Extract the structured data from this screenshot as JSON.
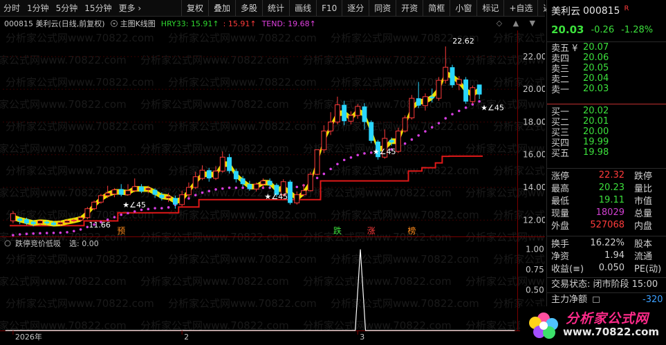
{
  "toolbar": {
    "left_items": [
      "分时",
      "1分钟",
      "5分钟",
      "15分钟",
      "更多 ›"
    ],
    "right_buttons": [
      "复权",
      "叠加",
      "多股",
      "统计",
      "画线",
      "F10",
      "逐分",
      "同资",
      "开资",
      "简框",
      "小窗",
      "标记",
      "+自选",
      "返回"
    ]
  },
  "chart_title": {
    "main": "000815 美利云(日线,前复权)",
    "indicator": "主图K线图",
    "hry": "HRY33: 15.91↑",
    "sub": ": 15.91↑",
    "tend": "TEND: 19.68↑",
    "controls": "◇ ▲ ▼"
  },
  "watermark_text": "分析家公式网www.70822.com",
  "chart_data": [
    {
      "type": "candlestick",
      "title": "000815 美利云(日线,前复权)",
      "y_axis_ticks": [
        12.0,
        14.0,
        16.0,
        18.0,
        20.0,
        22.0
      ],
      "ylim": [
        11.0,
        23.6
      ],
      "candles": [
        {
          "o": 11.95,
          "c": 12.4,
          "h": 12.55,
          "l": 11.8
        },
        {
          "o": 12.1,
          "c": 11.95,
          "h": 12.2,
          "l": 11.75
        },
        {
          "o": 12.05,
          "c": 11.8,
          "h": 12.15,
          "l": 11.7
        },
        {
          "o": 11.9,
          "c": 11.75,
          "h": 12.0,
          "l": 11.62
        },
        {
          "o": 11.8,
          "c": 11.95,
          "h": 12.05,
          "l": 11.66
        },
        {
          "o": 11.9,
          "c": 11.8,
          "h": 12.0,
          "l": 11.7
        },
        {
          "o": 11.85,
          "c": 11.7,
          "h": 11.95,
          "l": 11.66
        },
        {
          "o": 11.75,
          "c": 11.85,
          "h": 11.95,
          "l": 11.66
        },
        {
          "o": 11.85,
          "c": 11.95,
          "h": 12.05,
          "l": 11.8
        },
        {
          "o": 11.95,
          "c": 12.0,
          "h": 12.1,
          "l": 11.85
        },
        {
          "o": 12.0,
          "c": 12.15,
          "h": 12.25,
          "l": 11.9
        },
        {
          "o": 12.15,
          "c": 12.7,
          "h": 12.8,
          "l": 12.05
        },
        {
          "o": 12.7,
          "c": 13.1,
          "h": 13.2,
          "l": 12.6
        },
        {
          "o": 13.1,
          "c": 13.5,
          "h": 13.6,
          "l": 13.0
        },
        {
          "o": 13.5,
          "c": 13.65,
          "h": 14.1,
          "l": 13.35
        },
        {
          "o": 13.6,
          "c": 13.85,
          "h": 13.95,
          "l": 13.4
        },
        {
          "o": 13.9,
          "c": 13.55,
          "h": 14.2,
          "l": 13.45
        },
        {
          "o": 13.55,
          "c": 13.8,
          "h": 14.2,
          "l": 13.5
        },
        {
          "o": 13.8,
          "c": 14.05,
          "h": 14.55,
          "l": 13.7
        },
        {
          "o": 14.05,
          "c": 13.75,
          "h": 14.2,
          "l": 13.65
        },
        {
          "o": 13.85,
          "c": 13.95,
          "h": 14.1,
          "l": 13.65
        },
        {
          "o": 13.85,
          "c": 13.55,
          "h": 13.95,
          "l": 13.35
        },
        {
          "o": 13.55,
          "c": 13.35,
          "h": 13.7,
          "l": 13.2
        },
        {
          "o": 13.35,
          "c": 13.45,
          "h": 13.65,
          "l": 13.1
        },
        {
          "o": 13.35,
          "c": 12.95,
          "h": 13.5,
          "l": 12.7
        },
        {
          "o": 12.95,
          "c": 13.55,
          "h": 13.8,
          "l": 12.85
        },
        {
          "o": 13.55,
          "c": 14.0,
          "h": 14.3,
          "l": 13.4
        },
        {
          "o": 14.0,
          "c": 14.65,
          "h": 14.95,
          "l": 13.9
        },
        {
          "o": 14.55,
          "c": 15.05,
          "h": 15.35,
          "l": 14.45
        },
        {
          "o": 15.05,
          "c": 14.55,
          "h": 15.2,
          "l": 14.35
        },
        {
          "o": 14.55,
          "c": 15.0,
          "h": 15.3,
          "l": 14.45
        },
        {
          "o": 15.0,
          "c": 15.85,
          "h": 16.2,
          "l": 14.9
        },
        {
          "o": 15.85,
          "c": 15.0,
          "h": 16.05,
          "l": 14.85
        },
        {
          "o": 15.0,
          "c": 14.5,
          "h": 15.15,
          "l": 14.3
        },
        {
          "o": 14.55,
          "c": 14.2,
          "h": 14.7,
          "l": 14.05
        },
        {
          "o": 14.2,
          "c": 13.9,
          "h": 14.4,
          "l": 13.8
        },
        {
          "o": 13.9,
          "c": 14.2,
          "h": 14.3,
          "l": 13.75
        },
        {
          "o": 14.2,
          "c": 14.4,
          "h": 14.55,
          "l": 13.95
        },
        {
          "o": 14.4,
          "c": 14.15,
          "h": 14.55,
          "l": 13.95
        },
        {
          "o": 14.15,
          "c": 13.55,
          "h": 14.25,
          "l": 13.4
        },
        {
          "o": 13.55,
          "c": 14.35,
          "h": 14.5,
          "l": 13.45
        },
        {
          "o": 14.35,
          "c": 13.05,
          "h": 14.45,
          "l": 12.95
        },
        {
          "o": 13.05,
          "c": 13.55,
          "h": 13.75,
          "l": 12.95
        },
        {
          "o": 13.55,
          "c": 13.8,
          "h": 14.2,
          "l": 13.45
        },
        {
          "o": 13.8,
          "c": 14.8,
          "h": 14.95,
          "l": 13.75
        },
        {
          "o": 14.8,
          "c": 16.3,
          "h": 16.3,
          "l": 14.75
        },
        {
          "o": 16.3,
          "c": 17.45,
          "h": 17.8,
          "l": 16.1
        },
        {
          "o": 17.45,
          "c": 18.0,
          "h": 18.6,
          "l": 17.2
        },
        {
          "o": 18.0,
          "c": 19.05,
          "h": 19.55,
          "l": 17.85
        },
        {
          "o": 19.05,
          "c": 18.05,
          "h": 19.3,
          "l": 17.8
        },
        {
          "o": 18.05,
          "c": 18.4,
          "h": 18.65,
          "l": 17.85
        },
        {
          "o": 18.4,
          "c": 18.95,
          "h": 19.1,
          "l": 18.2
        },
        {
          "o": 18.95,
          "c": 18.0,
          "h": 19.15,
          "l": 17.55
        },
        {
          "o": 18.0,
          "c": 16.85,
          "h": 18.1,
          "l": 16.7
        },
        {
          "o": 16.8,
          "c": 15.85,
          "h": 16.9,
          "l": 15.7
        },
        {
          "o": 15.85,
          "c": 17.0,
          "h": 17.55,
          "l": 15.75
        },
        {
          "o": 16.9,
          "c": 16.75,
          "h": 17.05,
          "l": 16.55
        },
        {
          "o": 16.2,
          "c": 17.45,
          "h": 17.65,
          "l": 16.1
        },
        {
          "o": 17.45,
          "c": 18.25,
          "h": 18.4,
          "l": 17.35
        },
        {
          "o": 18.25,
          "c": 19.45,
          "h": 19.65,
          "l": 18.15
        },
        {
          "o": 19.45,
          "c": 19.0,
          "h": 20.45,
          "l": 18.85
        },
        {
          "o": 19.0,
          "c": 19.55,
          "h": 19.75,
          "l": 18.7
        },
        {
          "o": 19.55,
          "c": 19.45,
          "h": 20.05,
          "l": 19.2
        },
        {
          "o": 19.45,
          "c": 20.55,
          "h": 20.75,
          "l": 19.3
        },
        {
          "o": 20.55,
          "c": 21.35,
          "h": 22.62,
          "l": 20.35
        },
        {
          "o": 21.35,
          "c": 20.25,
          "h": 21.5,
          "l": 20.1
        },
        {
          "o": 20.3,
          "c": 20.6,
          "h": 20.8,
          "l": 19.95
        },
        {
          "o": 20.6,
          "c": 19.25,
          "h": 20.75,
          "l": 19.11
        },
        {
          "o": 19.25,
          "c": 20.1,
          "h": 20.23,
          "l": 19.11
        },
        {
          "o": 20.29,
          "c": 19.68,
          "h": 20.23,
          "l": 19.4
        }
      ],
      "hry_line": [
        11.66,
        11.66,
        11.66,
        11.66,
        11.66,
        11.66,
        11.66,
        11.66,
        11.66,
        11.66,
        11.66,
        11.95,
        11.95,
        11.95,
        11.95,
        11.95,
        12.45,
        12.45,
        12.45,
        12.45,
        12.45,
        12.45,
        12.45,
        12.45,
        12.45,
        12.8,
        12.8,
        12.8,
        13.25,
        13.25,
        13.25,
        13.25,
        13.25,
        13.25,
        13.25,
        13.25,
        13.25,
        13.25,
        13.25,
        13.25,
        13.25,
        13.25,
        13.25,
        13.25,
        13.25,
        13.25,
        14.4,
        14.4,
        14.4,
        14.4,
        14.4,
        14.4,
        14.4,
        14.4,
        14.4,
        14.4,
        14.4,
        14.4,
        14.4,
        15.0,
        15.0,
        15.2,
        15.2,
        15.5,
        15.9,
        15.91,
        15.91,
        15.91,
        15.91,
        15.91
      ],
      "tend_dots": [
        11.5,
        11.55,
        11.58,
        11.6,
        11.62,
        11.63,
        11.64,
        11.65,
        11.68,
        11.75,
        11.85,
        12.0,
        12.15,
        12.3,
        12.45,
        12.6,
        12.75,
        12.85,
        12.95,
        13.05,
        13.1,
        13.15,
        13.15,
        13.2,
        13.35,
        13.55,
        13.75,
        13.95,
        14.1,
        14.2,
        14.3,
        14.35,
        14.4,
        14.4,
        14.4,
        14.4,
        14.4,
        14.4,
        14.4,
        14.4,
        14.4,
        14.4,
        14.45,
        14.55,
        14.75,
        15.0,
        15.25,
        15.55,
        15.85,
        16.1,
        16.25,
        16.4,
        16.5,
        16.55,
        16.6,
        16.65,
        16.75,
        16.9,
        17.1,
        17.35,
        17.6,
        17.85,
        18.1,
        18.35,
        18.65,
        18.9,
        19.1,
        19.3,
        19.5,
        19.68
      ],
      "markers": [
        {
          "i": 11,
          "text": "11.66"
        },
        {
          "i": 16,
          "text": "★∠45"
        },
        {
          "i": 37,
          "text": "★∠45"
        },
        {
          "i": 53,
          "text": "★∠45"
        },
        {
          "i": 75,
          "text": "★∠45"
        },
        {
          "i": 64,
          "text": "22.62"
        }
      ],
      "signal_labels": [
        {
          "i": 23,
          "text": "预",
          "color": "#ff8a1a"
        },
        {
          "i": 68,
          "text": "跌",
          "color": "#3ce03c"
        },
        {
          "i": 76,
          "text": "涨",
          "color": "#ff3b3b"
        },
        {
          "i": 84,
          "text": "榜",
          "color": "#ff8a1a"
        }
      ],
      "x_axis_labels": [
        {
          "text": "2026年",
          "i": 0
        },
        {
          "text": "2",
          "i": 25
        },
        {
          "text": "3",
          "i": 51
        }
      ]
    },
    {
      "type": "line",
      "title": "跌停竞价低吸",
      "series": [
        {
          "name": "选",
          "values": [
            0,
            0,
            0,
            0,
            0,
            0,
            0,
            0,
            0,
            0,
            0,
            0,
            0,
            0,
            0,
            0,
            0,
            0,
            0,
            0,
            0,
            0,
            0,
            0,
            0,
            0,
            0,
            0,
            0,
            0,
            0,
            0,
            0,
            0,
            0,
            0,
            0,
            0,
            0,
            0,
            0,
            0,
            0,
            0,
            0,
            0,
            0,
            0,
            0,
            0,
            0,
            0,
            0,
            0,
            0,
            0,
            0,
            0,
            0,
            0,
            0,
            0,
            0,
            0,
            0,
            0,
            0,
            0,
            0,
            1,
            0,
            0,
            0,
            0,
            0,
            0,
            0,
            0,
            0,
            0,
            0,
            0,
            0,
            0,
            0,
            0,
            0,
            0,
            0,
            0,
            0,
            0,
            0,
            0,
            0,
            0,
            0,
            0,
            0,
            0
          ]
        }
      ],
      "y_axis_ticks": [
        "1.00",
        "0.75",
        "0.50",
        "0.25"
      ],
      "ylim": [
        0,
        1.15
      ]
    }
  ],
  "sub_title": {
    "name": "跌停竞价低吸",
    "value": "选: 0.00"
  },
  "quote": {
    "name": "美利云",
    "code": "000815",
    "flag": "R",
    "price": "20.03",
    "change": "-0.26",
    "change_pct": "-1.28%",
    "sell": [
      {
        "label": "卖五 ¥",
        "price": "20.07"
      },
      {
        "label": "卖四",
        "price": "20.06"
      },
      {
        "label": "卖三",
        "price": "20.05"
      },
      {
        "label": "卖二",
        "price": "20.04"
      },
      {
        "label": "卖一",
        "price": "20.03"
      }
    ],
    "buy": [
      {
        "label": "买一",
        "price": "20.02"
      },
      {
        "label": "买二",
        "price": "20.01"
      },
      {
        "label": "买三",
        "price": "20.00"
      },
      {
        "label": "买四",
        "price": "19.99"
      },
      {
        "label": "买五",
        "price": "19.98"
      }
    ],
    "stats1": [
      {
        "label": "涨停",
        "value": "22.32",
        "color": "#ff3b3b",
        "right": "跌停"
      },
      {
        "label": "最高",
        "value": "20.23",
        "color": "#3ce03c",
        "right": "量比"
      },
      {
        "label": "最低",
        "value": "19.11",
        "color": "#3ce03c",
        "right": "市值"
      },
      {
        "label": "现量",
        "value": "18029",
        "color": "#d040d0",
        "right": "总量"
      },
      {
        "label": "外盘",
        "value": "527068",
        "color": "#ff3b3b",
        "right": "内盘"
      }
    ],
    "stats2": [
      {
        "label": "换手",
        "value": "16.22%",
        "color": "#d0d0d0",
        "right": "股本"
      },
      {
        "label": "净资",
        "value": "1.94",
        "color": "#d0d0d0",
        "right": "流通"
      },
      {
        "label": "收益(≡)",
        "value": "0.050",
        "color": "#d0d0d0",
        "right": "PE(动)"
      }
    ],
    "status": "交易状态: 闭市阶段 15:00",
    "main_flow_label": "主力净额",
    "main_flow_value": "-320"
  },
  "logo": {
    "text": "分析家公式网",
    "url": "www.70822.com"
  },
  "colors": {
    "up": "#ff3b3b",
    "down_fill": "#2ad6ff",
    "hry": "#e01818",
    "tend": "#d63ee0",
    "band": "#f5f000",
    "grid": "#3a0000",
    "axis": "#7a0000"
  }
}
